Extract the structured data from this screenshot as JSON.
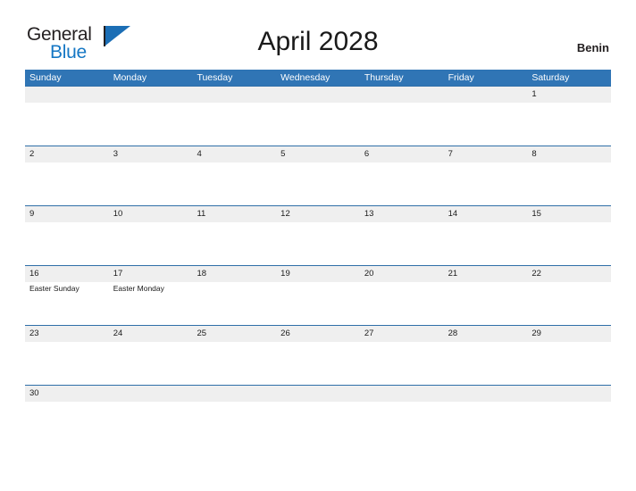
{
  "header": {
    "logo": {
      "word_one": "General",
      "word_two": "Blue",
      "flag_icon": "sail-flag-icon"
    },
    "title": "April 2028",
    "country": "Benin"
  },
  "colors": {
    "header_blue": "#3075b5",
    "row_border_blue": "#2f6fa8",
    "day_band_gray": "#efefef",
    "logo_blue": "#1577c4",
    "text_dark": "#1a1a1a"
  },
  "calendar": {
    "month": "April",
    "year": "2028",
    "weekdays": [
      "Sunday",
      "Monday",
      "Tuesday",
      "Wednesday",
      "Thursday",
      "Friday",
      "Saturday"
    ],
    "weeks": [
      {
        "days": [
          {
            "num": "",
            "event": ""
          },
          {
            "num": "",
            "event": ""
          },
          {
            "num": "",
            "event": ""
          },
          {
            "num": "",
            "event": ""
          },
          {
            "num": "",
            "event": ""
          },
          {
            "num": "",
            "event": ""
          },
          {
            "num": "1",
            "event": ""
          }
        ]
      },
      {
        "days": [
          {
            "num": "2",
            "event": ""
          },
          {
            "num": "3",
            "event": ""
          },
          {
            "num": "4",
            "event": ""
          },
          {
            "num": "5",
            "event": ""
          },
          {
            "num": "6",
            "event": ""
          },
          {
            "num": "7",
            "event": ""
          },
          {
            "num": "8",
            "event": ""
          }
        ]
      },
      {
        "days": [
          {
            "num": "9",
            "event": ""
          },
          {
            "num": "10",
            "event": ""
          },
          {
            "num": "11",
            "event": ""
          },
          {
            "num": "12",
            "event": ""
          },
          {
            "num": "13",
            "event": ""
          },
          {
            "num": "14",
            "event": ""
          },
          {
            "num": "15",
            "event": ""
          }
        ]
      },
      {
        "days": [
          {
            "num": "16",
            "event": "Easter Sunday"
          },
          {
            "num": "17",
            "event": "Easter Monday"
          },
          {
            "num": "18",
            "event": ""
          },
          {
            "num": "19",
            "event": ""
          },
          {
            "num": "20",
            "event": ""
          },
          {
            "num": "21",
            "event": ""
          },
          {
            "num": "22",
            "event": ""
          }
        ]
      },
      {
        "days": [
          {
            "num": "23",
            "event": ""
          },
          {
            "num": "24",
            "event": ""
          },
          {
            "num": "25",
            "event": ""
          },
          {
            "num": "26",
            "event": ""
          },
          {
            "num": "27",
            "event": ""
          },
          {
            "num": "28",
            "event": ""
          },
          {
            "num": "29",
            "event": ""
          }
        ]
      },
      {
        "days": [
          {
            "num": "30",
            "event": ""
          },
          {
            "num": "",
            "event": ""
          },
          {
            "num": "",
            "event": ""
          },
          {
            "num": "",
            "event": ""
          },
          {
            "num": "",
            "event": ""
          },
          {
            "num": "",
            "event": ""
          },
          {
            "num": "",
            "event": ""
          }
        ]
      }
    ]
  }
}
